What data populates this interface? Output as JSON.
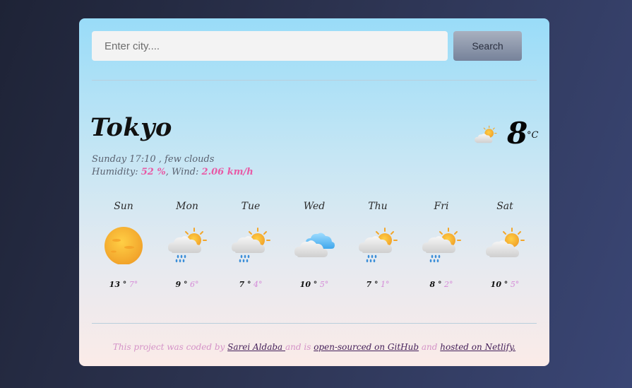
{
  "search": {
    "placeholder": "Enter city....",
    "button_label": "Search"
  },
  "current": {
    "city": "Tokyo",
    "datetime": "Sunday 17:10",
    "description": "few clouds",
    "humidity_label": "Humidity:",
    "humidity": "52 %",
    "wind_label": "Wind:",
    "wind": "2.06 km/h",
    "temp": "8",
    "unit": "°C",
    "icon": "sun-behind-cloud-icon"
  },
  "forecast": [
    {
      "day": "Sun",
      "max": "13 °",
      "min": "7°",
      "icon": "sun-icon"
    },
    {
      "day": "Mon",
      "max": "9 °",
      "min": "6°",
      "icon": "sun-cloud-rain-icon"
    },
    {
      "day": "Tue",
      "max": "7 °",
      "min": "4°",
      "icon": "sun-cloud-rain-icon"
    },
    {
      "day": "Wed",
      "max": "10 °",
      "min": "5°",
      "icon": "clouds-icon"
    },
    {
      "day": "Thu",
      "max": "7 °",
      "min": "1°",
      "icon": "sun-cloud-rain-icon"
    },
    {
      "day": "Fri",
      "max": "8 °",
      "min": "2°",
      "icon": "sun-cloud-rain-icon"
    },
    {
      "day": "Sat",
      "max": "10 °",
      "min": "5°",
      "icon": "sun-behind-cloud-icon"
    }
  ],
  "footer": {
    "prefix": "This project was coded by ",
    "author": "Sarei Aldaba ",
    "middle": "and is ",
    "github": "open-sourced on GitHub",
    "and": " and ",
    "netlify": "hosted on Netlify."
  },
  "colors": {
    "accent": "#e85aa5",
    "min_temp": "#d58ad7",
    "link": "#44205a"
  }
}
